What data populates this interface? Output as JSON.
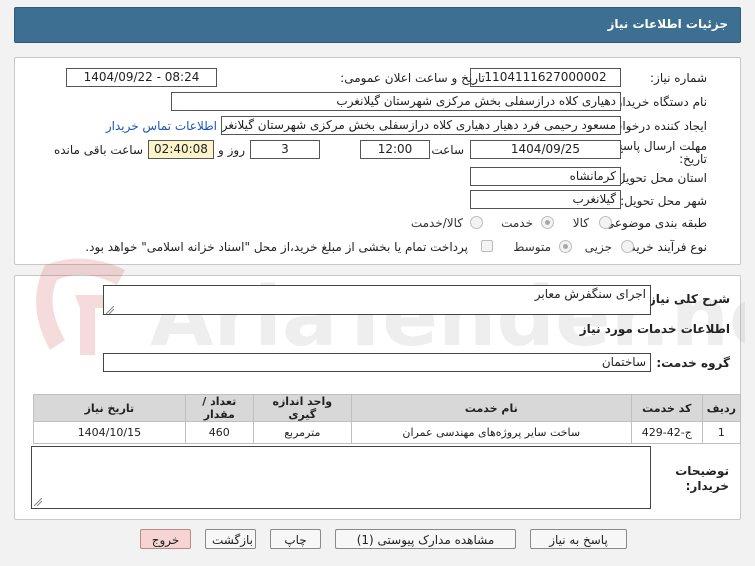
{
  "header": {
    "title": "جزئیات اطلاعات نیاز"
  },
  "form": {
    "need_number_label": "شماره نیاز:",
    "need_number_value": "1104111627000002",
    "announce_label": "تاریخ و ساعت اعلان عمومی:",
    "announce_value": "1404/09/22 - 08:24",
    "buyer_org_label": "نام دستگاه خریدار:",
    "buyer_org_value": "دهیاری کلاه درازسفلی بخش مرکزی شهرستان گیلانغرب",
    "creator_label": "ایجاد کننده درخواست:",
    "creator_value": "مسعود رحیمی فرد دهیار دهیاری کلاه درازسفلی بخش مرکزی شهرستان گیلانغرب",
    "contact_link": "اطلاعات تماس خریدار",
    "deadline_label_1": "مهلت ارسال پاسخ: تا",
    "deadline_label_2": "تاریخ:",
    "deadline_date": "1404/09/25",
    "time_label": "ساعت",
    "deadline_time": "12:00",
    "days_value": "3",
    "days_label": "روز و",
    "remaining_value": "02:40:08",
    "remaining_label": "ساعت باقی مانده",
    "province_label": "استان محل تحویل:",
    "province_value": "کرمانشاه",
    "city_label": "شهر محل تحویل:",
    "city_value": "گیلانغرب",
    "category_label": "طبقه بندی موضوعی:",
    "category_options": [
      "کالا",
      "خدمت",
      "کالا/خدمت"
    ],
    "category_selected": "خدمت",
    "process_label": "نوع فرآیند خرید :",
    "process_options": [
      "جزیی",
      "متوسط"
    ],
    "process_selected": "متوسط",
    "payment_note": "پرداخت تمام یا بخشی از مبلغ خرید،از محل \"اسناد خزانه اسلامی\" خواهد بود."
  },
  "details": {
    "description_label": "شرح کلی نیاز:",
    "description_value": "اجرای سنگفرش معابر",
    "services_title": "اطلاعات خدمات مورد نیاز",
    "service_group_label": "گروه خدمت:",
    "service_group_value": "ساختمان",
    "table": {
      "headers": [
        "ردیف",
        "کد خدمت",
        "نام خدمت",
        "واحد اندازه گیری",
        "تعداد / مقدار",
        "تاریخ نیاز"
      ],
      "rows": [
        [
          "1",
          "ج-42-429",
          "ساخت سایر پروژه‌های مهندسی عمران",
          "مترمربع",
          "460",
          "1404/10/15"
        ]
      ]
    },
    "buyer_notes_label_1": "توضیحات",
    "buyer_notes_label_2": "خریدار:",
    "buyer_notes_value": ""
  },
  "buttons": {
    "reply": "پاسخ به نیاز",
    "attachments": "مشاهده مدارک پیوستی (1)",
    "print": "چاپ",
    "back": "بازگشت",
    "exit": "خروج"
  },
  "watermark": {
    "text": "AriaTender.neT"
  },
  "colors": {
    "header": "#3d6f92",
    "link": "#1a56b8",
    "remaining_bg": "#fbf3c9",
    "exit_bg": "#f6d4d4"
  }
}
